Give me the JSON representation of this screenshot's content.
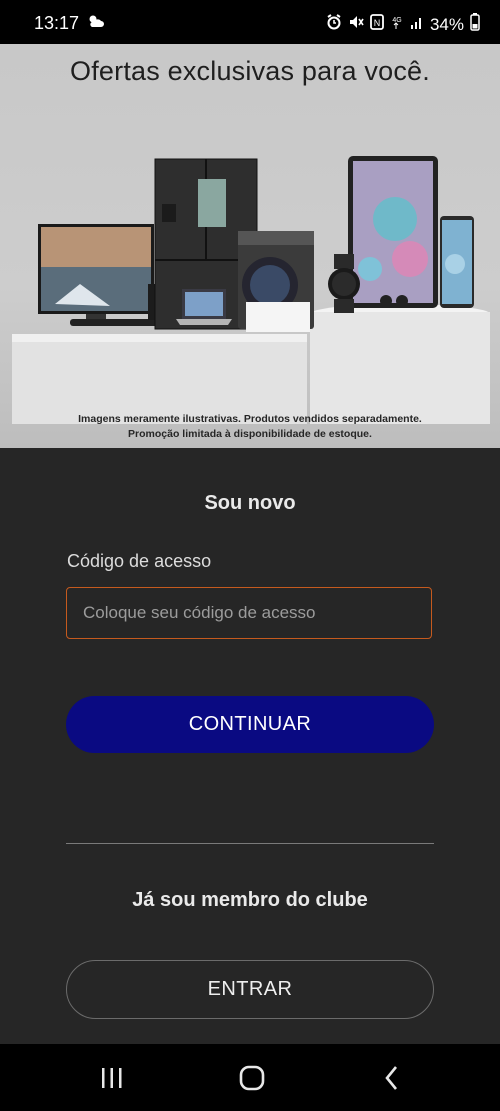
{
  "status_bar": {
    "time": "13:17",
    "battery": "34%",
    "icons": [
      "weather-icon",
      "alarm-icon",
      "mute-icon",
      "nfc-icon",
      "4g-icon",
      "signal-icon",
      "battery-icon"
    ]
  },
  "hero": {
    "title": "Ofertas exclusivas para você.",
    "note_line1": "Imagens meramente ilustrativas. Produtos vendidos separadamente.",
    "note_line2": "Promoção limitada à disponibilidade de estoque."
  },
  "new_member": {
    "title": "Sou novo",
    "field_label": "Código de acesso",
    "field_placeholder": "Coloque seu código de acesso",
    "field_value": "",
    "continue_label": "CONTINUAR"
  },
  "existing_member": {
    "title": "Já sou membro do clube",
    "enter_label": "ENTRAR"
  },
  "colors": {
    "background": "#262626",
    "primary_button": "#0a0a82",
    "input_border": "#c55a1e"
  },
  "nav_bar": {
    "icons": [
      "recent-apps-icon",
      "home-icon",
      "back-icon"
    ]
  }
}
